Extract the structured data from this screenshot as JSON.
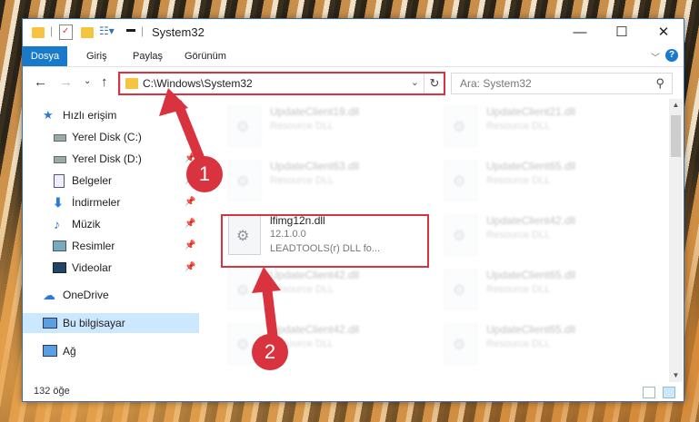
{
  "window": {
    "title": "System32",
    "controls": {
      "minimize": "—",
      "maximize": "☐",
      "close": "✕"
    }
  },
  "ribbon": {
    "tabs": [
      "Dosya",
      "Giriş",
      "Paylaş",
      "Görünüm"
    ],
    "active_tab": "Dosya",
    "help": "?"
  },
  "navigation": {
    "address": "C:\\Windows\\System32",
    "search_placeholder": "Ara: System32"
  },
  "sidebar": {
    "items": [
      {
        "label": "Hızlı erişim",
        "icon": "star-icon",
        "pinned": false,
        "selected": false
      },
      {
        "label": "Yerel Disk (C:)",
        "icon": "drive-icon",
        "pinned": true,
        "selected": false
      },
      {
        "label": "Yerel Disk (D:)",
        "icon": "drive-icon",
        "pinned": true,
        "selected": false
      },
      {
        "label": "Belgeler",
        "icon": "documents-icon",
        "pinned": true,
        "selected": false
      },
      {
        "label": "İndirmeler",
        "icon": "download-icon",
        "pinned": true,
        "selected": false
      },
      {
        "label": "Müzik",
        "icon": "music-icon",
        "pinned": true,
        "selected": false
      },
      {
        "label": "Resimler",
        "icon": "pictures-icon",
        "pinned": true,
        "selected": false
      },
      {
        "label": "Videolar",
        "icon": "videos-icon",
        "pinned": true,
        "selected": false
      },
      {
        "label": "OneDrive",
        "icon": "cloud-icon",
        "pinned": false,
        "selected": false
      },
      {
        "label": "Bu bilgisayar",
        "icon": "computer-icon",
        "pinned": false,
        "selected": true
      },
      {
        "label": "Ağ",
        "icon": "network-icon",
        "pinned": false,
        "selected": false
      }
    ]
  },
  "files": [
    {
      "name": "UpdateClient19.dll",
      "sub1": "Resource DLL",
      "sub2": "",
      "highlight": false
    },
    {
      "name": "UpdateClient21.dll",
      "sub1": "Resource DLL",
      "sub2": "",
      "highlight": false
    },
    {
      "name": "UpdateClient63.dll",
      "sub1": "Resource DLL",
      "sub2": "",
      "highlight": false
    },
    {
      "name": "UpdateClient65.dll",
      "sub1": "Resource DLL",
      "sub2": "",
      "highlight": false
    },
    {
      "name": "lfimg12n.dll",
      "sub1": "12.1.0.0",
      "sub2": "LEADTOOLS(r) DLL fo...",
      "highlight": true
    },
    {
      "name": "UpdateClient42.dll",
      "sub1": "Resource DLL",
      "sub2": "",
      "highlight": false
    },
    {
      "name": "UpdateClient42.dll",
      "sub1": "Resource DLL",
      "sub2": "",
      "highlight": false
    },
    {
      "name": "UpdateClient65.dll",
      "sub1": "Resource DLL",
      "sub2": "",
      "highlight": false
    },
    {
      "name": "UpdateClient42.dll",
      "sub1": "Resource DLL",
      "sub2": "",
      "highlight": false
    },
    {
      "name": "UpdateClient65.dll",
      "sub1": "Resource DLL",
      "sub2": "",
      "highlight": false
    }
  ],
  "status": {
    "count": "132 öğe"
  },
  "annotations": {
    "step1": "1",
    "step2": "2",
    "color": "#d9333f"
  }
}
